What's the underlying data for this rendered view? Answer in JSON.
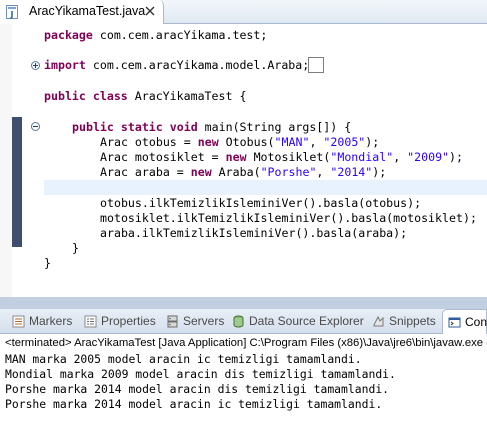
{
  "editor": {
    "tab": {
      "title": "AracYikamaTest.java",
      "close_symbol": "✕"
    },
    "code": {
      "package": {
        "keyword": "package",
        "rest": " com.cem.aracYikama.test;"
      },
      "import": {
        "keyword": "import",
        "rest": " com.cem.aracYikama.model.Araba;"
      },
      "class_decl": {
        "kw1": "public",
        "kw2": "class",
        "rest": " AracYikamaTest {"
      },
      "main_decl": {
        "kw1": "public",
        "kw2": "static",
        "kw3": "void",
        "rest": " main(String args[]) {"
      },
      "line_otobus": {
        "pre": "Arac otobus = ",
        "kw": "new",
        "mid": " Otobus(",
        "s1": "\"MAN\"",
        "sep": ", ",
        "s2": "\"2005\"",
        "end": ");"
      },
      "line_motosiklet": {
        "pre": "Arac motosiklet = ",
        "kw": "new",
        "mid": " Motosiklet(",
        "s1": "\"Mondial\"",
        "sep": ", ",
        "s2": "\"2009\"",
        "end": ");"
      },
      "line_araba": {
        "pre": "Arac araba = ",
        "kw": "new",
        "mid": " Araba(",
        "s1": "\"Porshe\"",
        "sep": ", ",
        "s2": "\"2014\"",
        "end": ");"
      },
      "call_otobus": "otobus.ilkTemizlikIsleminiVer().basla(otobus);",
      "call_motosiklet": "motosiklet.ilkTemizlikIsleminiVer().basla(motosiklet);",
      "call_araba": "araba.ilkTemizlikIsleminiVer().basla(araba);",
      "close_method": "}",
      "close_class": "}"
    }
  },
  "views": {
    "tabs": [
      {
        "label": "Markers",
        "icon": "markers-icon"
      },
      {
        "label": "Properties",
        "icon": "properties-icon"
      },
      {
        "label": "Servers",
        "icon": "servers-icon"
      },
      {
        "label": "Data Source Explorer",
        "icon": "data-source-icon"
      },
      {
        "label": "Snippets",
        "icon": "snippets-icon"
      },
      {
        "label": "Con",
        "icon": "console-icon"
      }
    ]
  },
  "console": {
    "terminated": "<terminated> AracYikamaTest [Java Application] C:\\Program Files (x86)\\Java\\jre6\\bin\\javaw.exe (",
    "lines": [
      "MAN marka 2005 model aracin ic temizligi tamamlandi.",
      "Mondial marka 2009 model aracin dis temizligi tamamlandi.",
      "Porshe marka 2014 model aracin dis temizligi tamamlandi.",
      "Porshe marka 2014 model aracin ic temizligi tamamlandi."
    ]
  },
  "colors": {
    "keyword": "#7f0055",
    "string": "#2a00ff",
    "current_line": "#e8f2fe",
    "occurrence_band": "#3e4e6f",
    "tab_border": "#a9bad1"
  }
}
